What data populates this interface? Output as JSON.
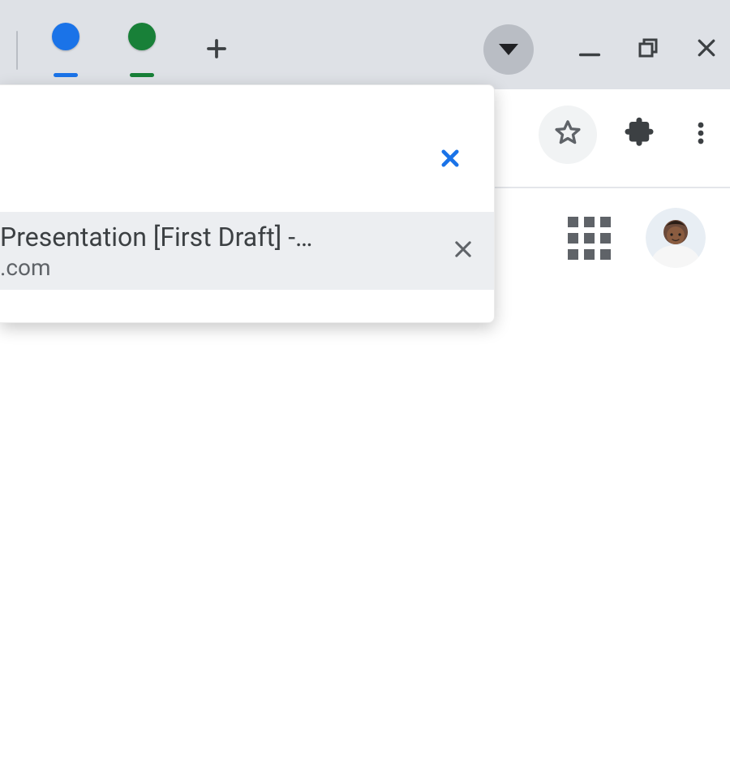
{
  "titlebar": {
    "tab_dots": [
      {
        "color": "#1a73e8"
      },
      {
        "color": "#188038"
      }
    ]
  },
  "tab_search": {
    "result": {
      "title_fragment": " Presentation [First Draft] -…",
      "url_fragment": ".com"
    }
  }
}
